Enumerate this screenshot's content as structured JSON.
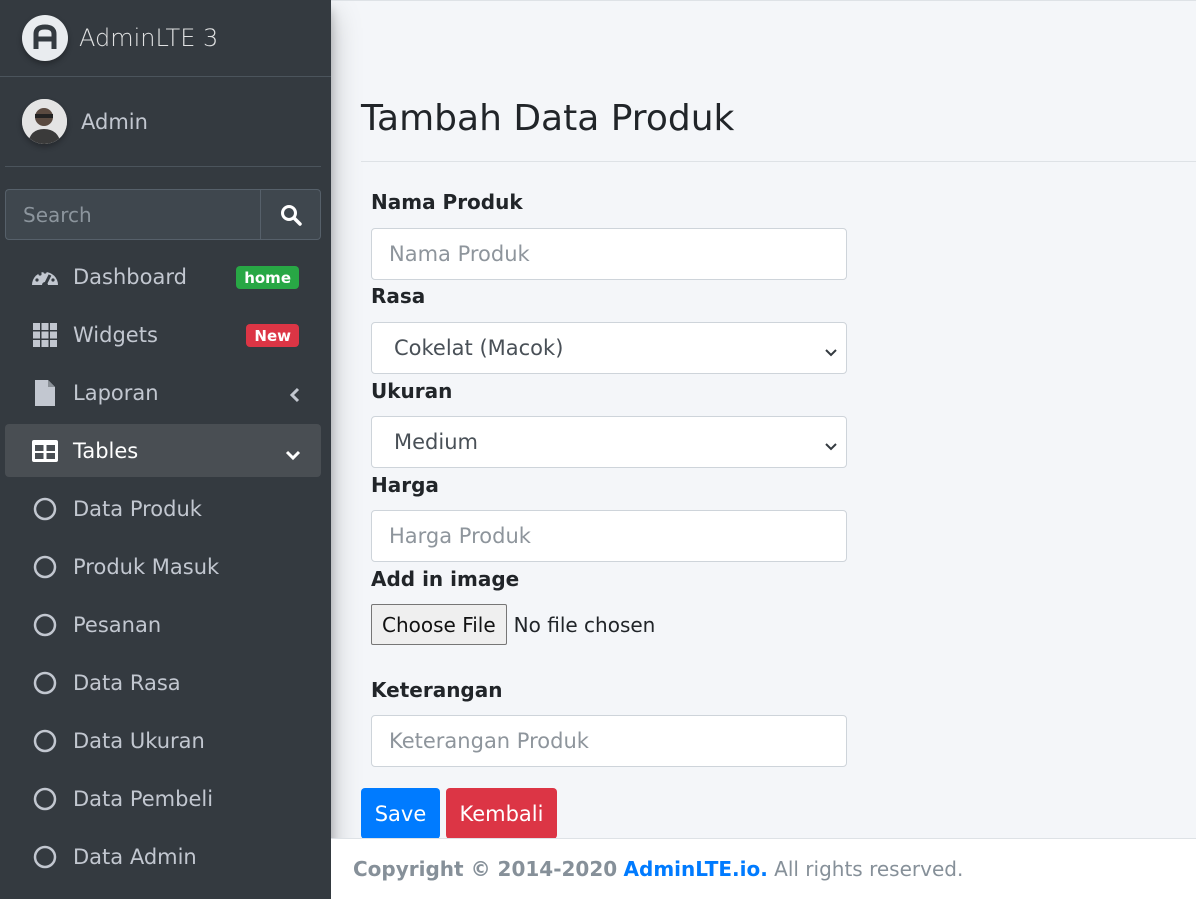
{
  "brand": {
    "title": "AdminLTE 3",
    "icon": "adminlte-logo-icon"
  },
  "user": {
    "name": "Admin"
  },
  "search": {
    "placeholder": "Search"
  },
  "nav": {
    "dashboard": {
      "label": "Dashboard",
      "badge": "home",
      "badge_color": "#28a745"
    },
    "widgets": {
      "label": "Widgets",
      "badge": "New",
      "badge_color": "#dc3545"
    },
    "laporan": {
      "label": "Laporan"
    },
    "tables": {
      "label": "Tables"
    },
    "sub": [
      "Data Produk",
      "Produk Masuk",
      "Pesanan",
      "Data Rasa",
      "Data Ukuran",
      "Data Pembeli",
      "Data Admin"
    ]
  },
  "page": {
    "title": "Tambah Data Produk"
  },
  "form": {
    "nama_label": "Nama Produk",
    "nama_placeholder": "Nama Produk",
    "rasa_label": "Rasa",
    "rasa_value": "Cokelat (Macok)",
    "ukuran_label": "Ukuran",
    "ukuran_value": "Medium",
    "harga_label": "Harga",
    "harga_placeholder": "Harga Produk",
    "image_label": "Add in image",
    "file_button": "Choose File",
    "file_status": "No file chosen",
    "keterangan_label": "Keterangan",
    "keterangan_placeholder": "Keterangan Produk",
    "save": "Save",
    "back": "Kembali"
  },
  "footer": {
    "copyright": "Copyright © 2014-2020",
    "link": "AdminLTE.io.",
    "rest": "All rights reserved."
  },
  "colors": {
    "sidebar": "#343a40",
    "primary": "#007bff",
    "danger": "#dc3545",
    "success": "#28a745"
  }
}
